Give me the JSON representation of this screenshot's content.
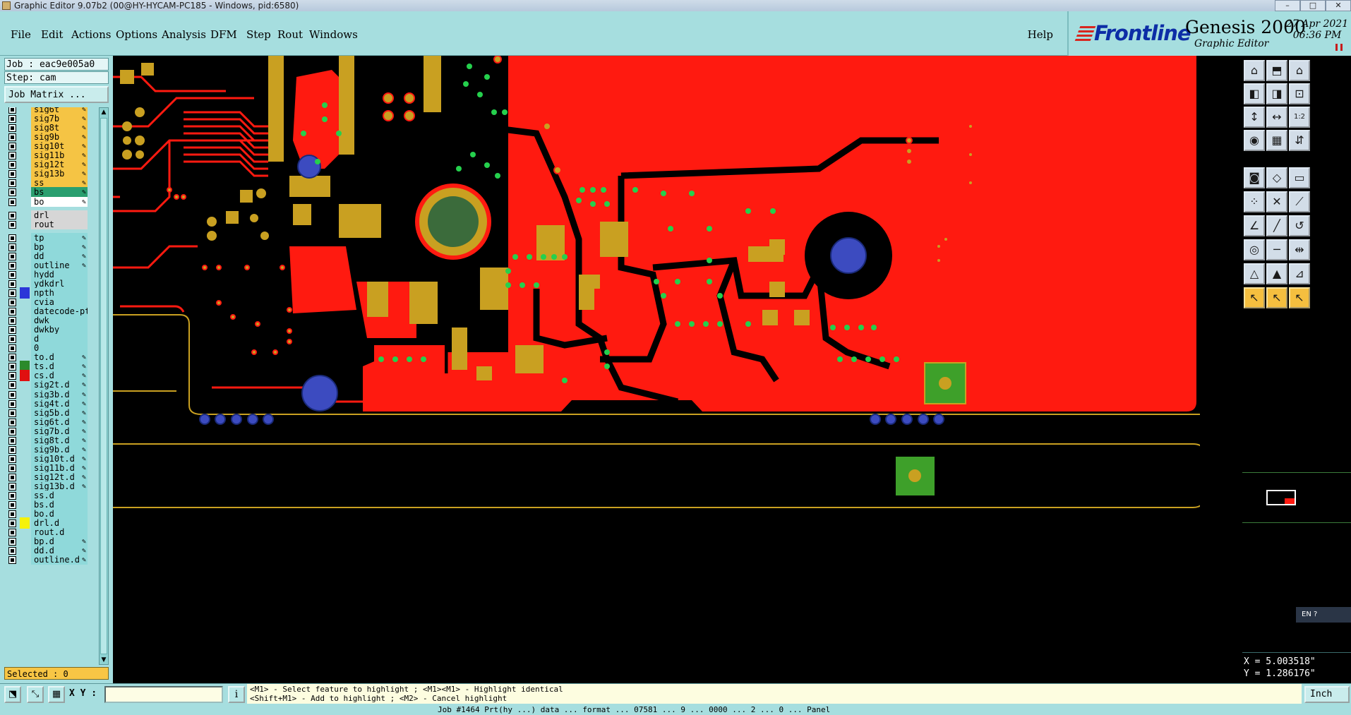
{
  "window": {
    "title": "Graphic Editor 9.07b2 (00@HY-HYCAM-PC185 - Windows, pid:6580)",
    "controls": [
      "–",
      "□",
      "✕"
    ]
  },
  "menubar": {
    "items": [
      "File",
      "Edit",
      "Actions",
      "Options",
      "Analysis",
      "DFM",
      "Step",
      "Rout",
      "Windows"
    ],
    "help": "Help"
  },
  "brand": {
    "logo": "Frontline",
    "product": "Genesis 2000",
    "subtitle": "Graphic Editor",
    "date": "27 Apr 2021",
    "time": "06:36 PM"
  },
  "job": {
    "job_label": "Job : eac9e005a0",
    "step_label": "Step: cam",
    "matrix_button": "Job Matrix ..."
  },
  "layers": [
    {
      "name": "sig6t",
      "bg": "#f5c444",
      "color": "",
      "edit": "✎"
    },
    {
      "name": "sig7b",
      "bg": "#f5c444",
      "color": "",
      "edit": "✎"
    },
    {
      "name": "sig8t",
      "bg": "#f5c444",
      "color": "",
      "edit": "✎"
    },
    {
      "name": "sig9b",
      "bg": "#f5c444",
      "color": "",
      "edit": "✎"
    },
    {
      "name": "sig10t",
      "bg": "#f5c444",
      "color": "",
      "edit": "✎"
    },
    {
      "name": "sig11b",
      "bg": "#f5c444",
      "color": "",
      "edit": "✎"
    },
    {
      "name": "sig12t",
      "bg": "#f5c444",
      "color": "",
      "edit": "✎"
    },
    {
      "name": "sig13b",
      "bg": "#f5c444",
      "color": "",
      "edit": "✎"
    },
    {
      "name": "ss",
      "bg": "#f5c444",
      "color": "",
      "edit": "✎"
    },
    {
      "name": "bs",
      "bg": "#2a9f6f",
      "color": "",
      "edit": "✎"
    },
    {
      "name": "bo",
      "bg": "#ffffff",
      "color": "",
      "edit": "✎"
    },
    {
      "name": "drl",
      "bg": "#d6d6d6",
      "color": "",
      "edit": ""
    },
    {
      "name": "rout",
      "bg": "#d6d6d6",
      "color": "",
      "edit": ""
    },
    {
      "name": "tp",
      "bg": "#8fd9da",
      "color": "",
      "edit": "✎"
    },
    {
      "name": "bp",
      "bg": "#8fd9da",
      "color": "",
      "edit": "✎"
    },
    {
      "name": "dd",
      "bg": "#8fd9da",
      "color": "",
      "edit": "✎"
    },
    {
      "name": "outline",
      "bg": "#8fd9da",
      "color": "",
      "edit": "✎"
    },
    {
      "name": "hydd",
      "bg": "#8fd9da",
      "color": "",
      "edit": ""
    },
    {
      "name": "ydkdrl",
      "bg": "#8fd9da",
      "color": "",
      "edit": ""
    },
    {
      "name": "npth",
      "bg": "#8fd9da",
      "color": "#2b36d8",
      "edit": ""
    },
    {
      "name": "cvia",
      "bg": "#8fd9da",
      "color": "",
      "edit": ""
    },
    {
      "name": "datecode-pt",
      "bg": "#8fd9da",
      "color": "",
      "edit": ""
    },
    {
      "name": "dwk",
      "bg": "#8fd9da",
      "color": "",
      "edit": ""
    },
    {
      "name": "dwkby",
      "bg": "#8fd9da",
      "color": "",
      "edit": ""
    },
    {
      "name": "d",
      "bg": "#8fd9da",
      "color": "",
      "edit": ""
    },
    {
      "name": "0",
      "bg": "#8fd9da",
      "color": "",
      "edit": ""
    },
    {
      "name": "to.d",
      "bg": "#8fd9da",
      "color": "",
      "edit": "✎"
    },
    {
      "name": "ts.d",
      "bg": "#8fd9da",
      "color": "#2b8a2b",
      "edit": "✎"
    },
    {
      "name": "cs.d",
      "bg": "#8fd9da",
      "color": "#e01010",
      "edit": "✎"
    },
    {
      "name": "sig2t.d",
      "bg": "#8fd9da",
      "color": "",
      "edit": "✎"
    },
    {
      "name": "sig3b.d",
      "bg": "#8fd9da",
      "color": "",
      "edit": "✎"
    },
    {
      "name": "sig4t.d",
      "bg": "#8fd9da",
      "color": "",
      "edit": "✎"
    },
    {
      "name": "sig5b.d",
      "bg": "#8fd9da",
      "color": "",
      "edit": "✎"
    },
    {
      "name": "sig6t.d",
      "bg": "#8fd9da",
      "color": "",
      "edit": "✎"
    },
    {
      "name": "sig7b.d",
      "bg": "#8fd9da",
      "color": "",
      "edit": "✎"
    },
    {
      "name": "sig8t.d",
      "bg": "#8fd9da",
      "color": "",
      "edit": "✎"
    },
    {
      "name": "sig9b.d",
      "bg": "#8fd9da",
      "color": "",
      "edit": "✎"
    },
    {
      "name": "sig10t.d",
      "bg": "#8fd9da",
      "color": "",
      "edit": "✎"
    },
    {
      "name": "sig11b.d",
      "bg": "#8fd9da",
      "color": "",
      "edit": "✎"
    },
    {
      "name": "sig12t.d",
      "bg": "#8fd9da",
      "color": "",
      "edit": "✎"
    },
    {
      "name": "sig13b.d",
      "bg": "#8fd9da",
      "color": "",
      "edit": "✎"
    },
    {
      "name": "ss.d",
      "bg": "#8fd9da",
      "color": "",
      "edit": ""
    },
    {
      "name": "bs.d",
      "bg": "#8fd9da",
      "color": "",
      "edit": ""
    },
    {
      "name": "bo.d",
      "bg": "#8fd9da",
      "color": "",
      "edit": ""
    },
    {
      "name": "drl.d",
      "bg": "#8fd9da",
      "color": "#f5f20a",
      "edit": ""
    },
    {
      "name": "rout.d",
      "bg": "#8fd9da",
      "color": "",
      "edit": ""
    },
    {
      "name": "bp.d",
      "bg": "#8fd9da",
      "color": "",
      "edit": "✎"
    },
    {
      "name": "dd.d",
      "bg": "#8fd9da",
      "color": "",
      "edit": "✎"
    },
    {
      "name": "outline.d",
      "bg": "#8fd9da",
      "color": "",
      "edit": "✎"
    }
  ],
  "selected": "Selected : 0",
  "coords": {
    "x": "X = 5.003518\"",
    "y": "Y = 1.286176\""
  },
  "bottom": {
    "xy_label": "X Y :",
    "xy_value": "",
    "info_icon": "i",
    "hint_line1": "<M1> - Select feature to highlight ; <M1><M1> - Highlight identical",
    "hint_line2": "<Shift+M1> - Add to highlight ; <M2> - Cancel highlight",
    "units": "Inch",
    "status": "Job #1464 Prt(hy ...) data ... format ... 07581 ... 9 ... 0000 ... 2 ... 0 ... Panel"
  },
  "ime": {
    "lang": "EN"
  },
  "colors": {
    "ui_teal": "#a6dedf",
    "copper": "#ff1a10",
    "pad": "#c9a021",
    "via": "#25d04d",
    "npth": "#3c4bc0",
    "outline": "#c9a021",
    "brand_blue": "#0c2da6"
  },
  "toolbox": [
    {
      "icon": "zoom-home-icon",
      "glyph": "⌂",
      "style": "light"
    },
    {
      "icon": "zoom-out-icon",
      "glyph": "⬒",
      "style": "light"
    },
    {
      "icon": "home-icon",
      "glyph": "⌂",
      "style": "light"
    },
    {
      "icon": "pan-left-icon",
      "glyph": "◧",
      "style": "light"
    },
    {
      "icon": "pan-right-icon",
      "glyph": "◨",
      "style": "light"
    },
    {
      "icon": "zoom-fit-icon",
      "glyph": "⊡",
      "style": "light"
    },
    {
      "icon": "fit-vertical-icon",
      "glyph": "↕",
      "style": "light"
    },
    {
      "icon": "fit-horizontal-icon",
      "glyph": "↔",
      "style": "light"
    },
    {
      "icon": "ratio-icon",
      "glyph": "1:2",
      "style": "light"
    },
    {
      "icon": "snapshot-icon",
      "glyph": "◉",
      "style": "light"
    },
    {
      "icon": "grid-icon",
      "glyph": "▦",
      "style": "light"
    },
    {
      "icon": "net-icon",
      "glyph": "⇵",
      "style": "light"
    },
    {
      "icon": "measure-icon",
      "glyph": "◙",
      "style": "light"
    },
    {
      "icon": "shape-icon",
      "glyph": "◇",
      "style": "light"
    },
    {
      "icon": "ruler-icon",
      "glyph": "▭",
      "style": "light"
    },
    {
      "icon": "node-icon",
      "glyph": "⁘",
      "style": "light"
    },
    {
      "icon": "cross-icon",
      "glyph": "✕",
      "style": "light"
    },
    {
      "icon": "connect-icon",
      "glyph": "⟋",
      "style": "light"
    },
    {
      "icon": "angle-icon",
      "glyph": "∠",
      "style": "light"
    },
    {
      "icon": "line-icon",
      "glyph": "╱",
      "style": "light"
    },
    {
      "icon": "arc-icon",
      "glyph": "↺",
      "style": "light"
    },
    {
      "icon": "target-icon",
      "glyph": "◎",
      "style": "light"
    },
    {
      "icon": "segment-icon",
      "glyph": "─",
      "style": "light"
    },
    {
      "icon": "measure-h-icon",
      "glyph": "⇹",
      "style": "light"
    },
    {
      "icon": "triangle-icon",
      "glyph": "△",
      "style": "light"
    },
    {
      "icon": "triangle-alt-icon",
      "glyph": "▲",
      "style": "light"
    },
    {
      "icon": "triangle-fill-icon",
      "glyph": "⊿",
      "style": "light"
    },
    {
      "icon": "pointer-icon",
      "glyph": "↖",
      "style": "yellow"
    },
    {
      "icon": "pointer-select-icon",
      "glyph": "↖",
      "style": "yellow"
    },
    {
      "icon": "pointer-edit-icon",
      "glyph": "↖",
      "style": "yellow"
    }
  ]
}
